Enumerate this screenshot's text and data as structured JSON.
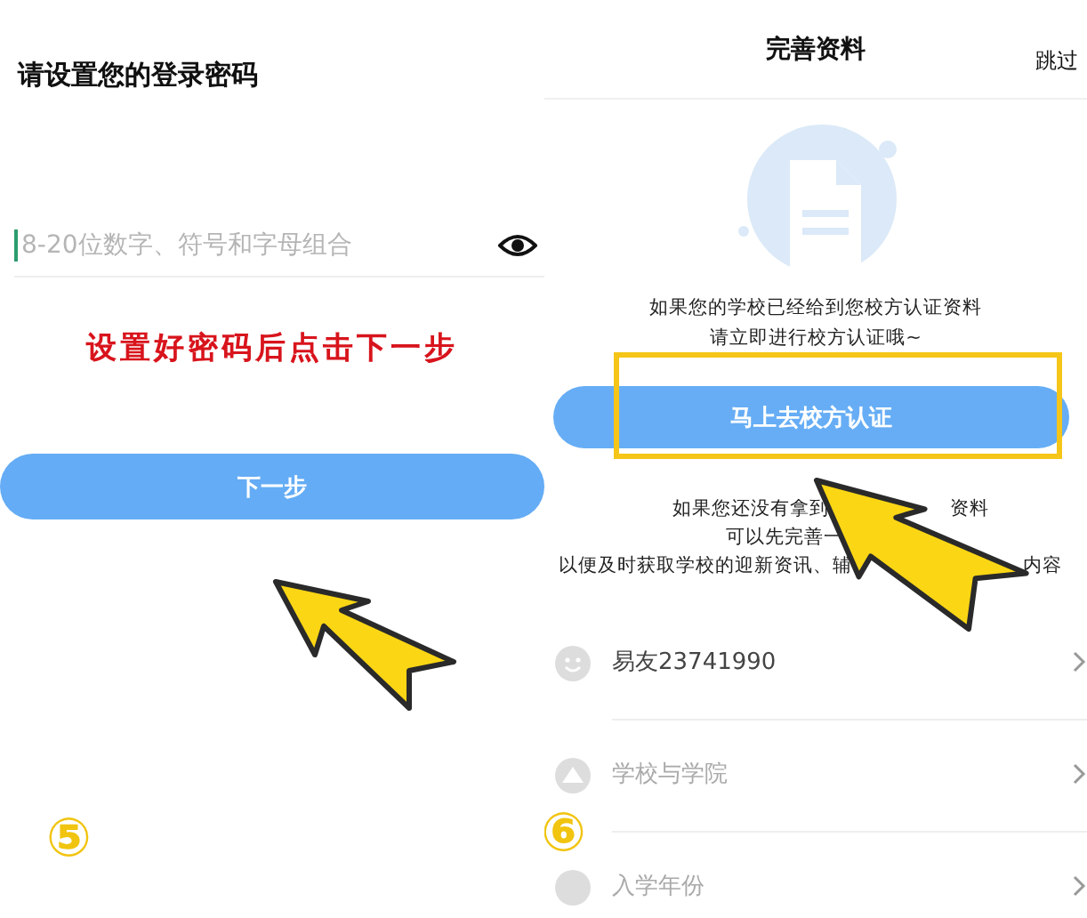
{
  "password_screen": {
    "title": "请设置您的登录密码",
    "password_field": {
      "placeholder": "8-20位数字、符号和字母组合"
    },
    "annotation": "设置好密码后点击下一步",
    "next_button": "下一步",
    "step_badge": "⑤"
  },
  "profile_screen": {
    "title": "完善资料",
    "skip": "跳过",
    "intro_lines": [
      "如果您的学校已经给到您校方认证资料",
      "请立即进行校方认证哦~"
    ],
    "verify_button": "马上去校方认证",
    "note_lines": [
      [
        "如果您还没有拿到",
        "资料"
      ],
      [
        "可以先完善一"
      ],
      [
        "以便及时获取学校的迎新资讯、辅",
        "内容"
      ]
    ],
    "rows": [
      {
        "label": "易友23741990",
        "filled": true
      },
      {
        "label": "学校与学院",
        "filled": false
      },
      {
        "label": "入学年份",
        "filled": false
      }
    ],
    "step_badge": "⑥"
  }
}
